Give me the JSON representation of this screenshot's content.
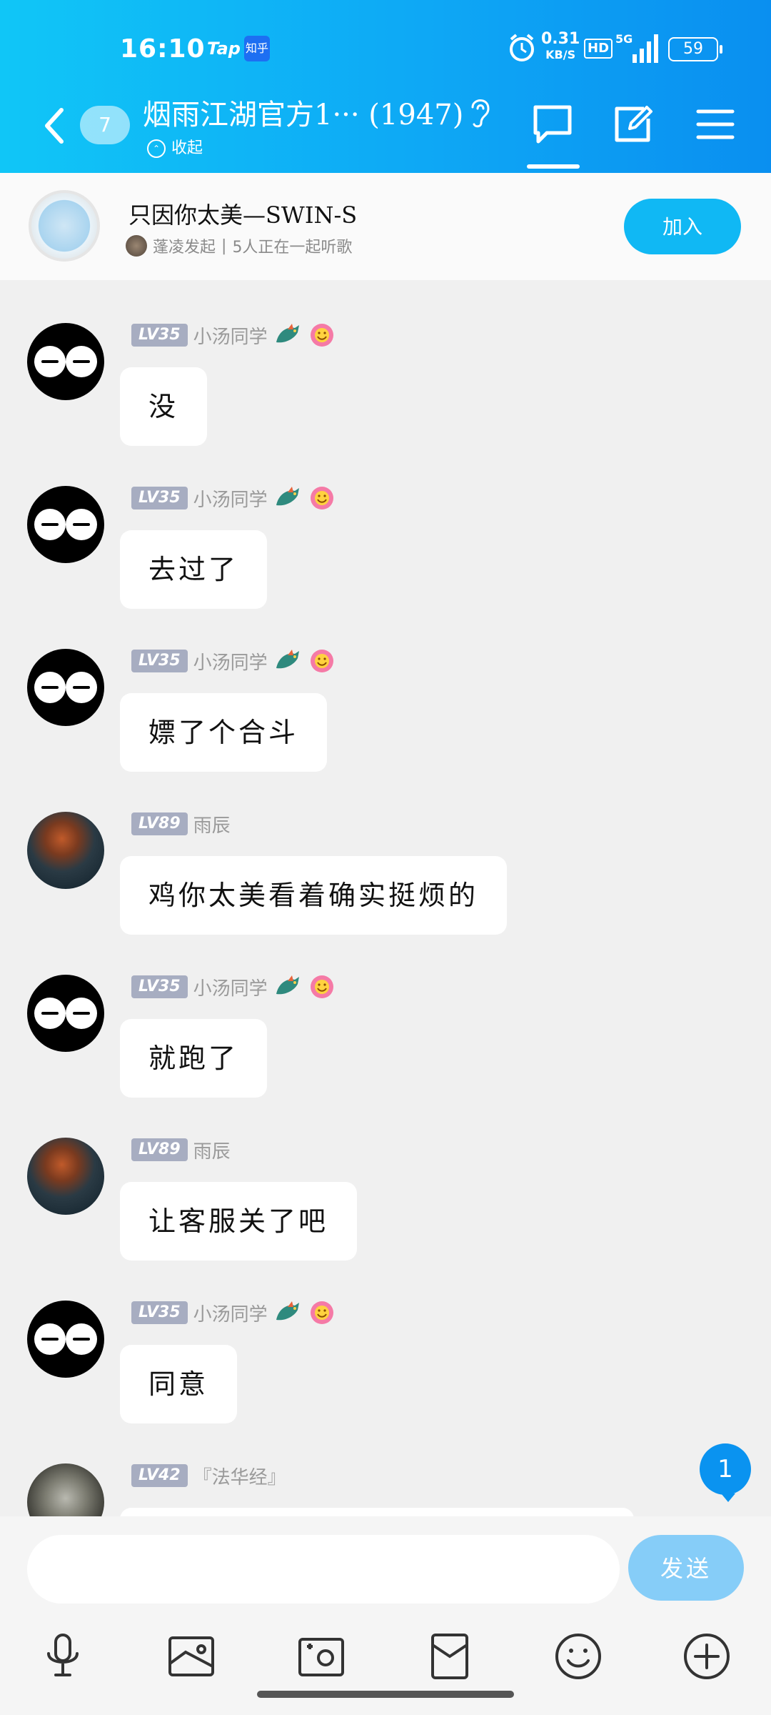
{
  "status_bar": {
    "time": "16:10",
    "app_tap": "Tap",
    "app_zhihu": "知乎",
    "net_speed_value": "0.31",
    "net_speed_unit": "KB/S",
    "hd": "HD",
    "network": "5G",
    "battery": "59"
  },
  "header": {
    "unread_count": "7",
    "title": "烟雨江湖官方1··· (1947)",
    "collapse_label": "收起",
    "accent_color": "#0ea8f5"
  },
  "music": {
    "song_title": "只因你太美—SWIN-S",
    "initiator": "蓬凌发起",
    "listeners": "5人正在一起听歌",
    "join_label": "加入"
  },
  "messages": [
    {
      "level": "LV35",
      "nickname": "小汤同学",
      "text": "没",
      "avatar": "black-eyes"
    },
    {
      "level": "LV35",
      "nickname": "小汤同学",
      "text": "去过了",
      "avatar": "black-eyes"
    },
    {
      "level": "LV35",
      "nickname": "小汤同学",
      "text": "嫖了个合斗",
      "avatar": "black-eyes"
    },
    {
      "level": "LV89",
      "nickname": "雨辰",
      "text": "鸡你太美看着确实挺烦的",
      "avatar": "warrior"
    },
    {
      "level": "LV35",
      "nickname": "小汤同学",
      "text": "就跑了",
      "avatar": "black-eyes"
    },
    {
      "level": "LV89",
      "nickname": "雨辰",
      "text": "让客服关了吧",
      "avatar": "warrior"
    },
    {
      "level": "LV35",
      "nickname": "小汤同学",
      "text": "同意",
      "avatar": "black-eyes"
    },
    {
      "level": "LV42",
      "nickname": "『法华经』",
      "text": "",
      "avatar": "statue"
    }
  ],
  "new_message_badge": "1",
  "composer": {
    "placeholder": "",
    "send_label": "发送"
  },
  "toolbar_icons": [
    "microphone-icon",
    "image-icon",
    "camera-icon",
    "red-packet-icon",
    "emoji-icon",
    "plus-icon"
  ]
}
